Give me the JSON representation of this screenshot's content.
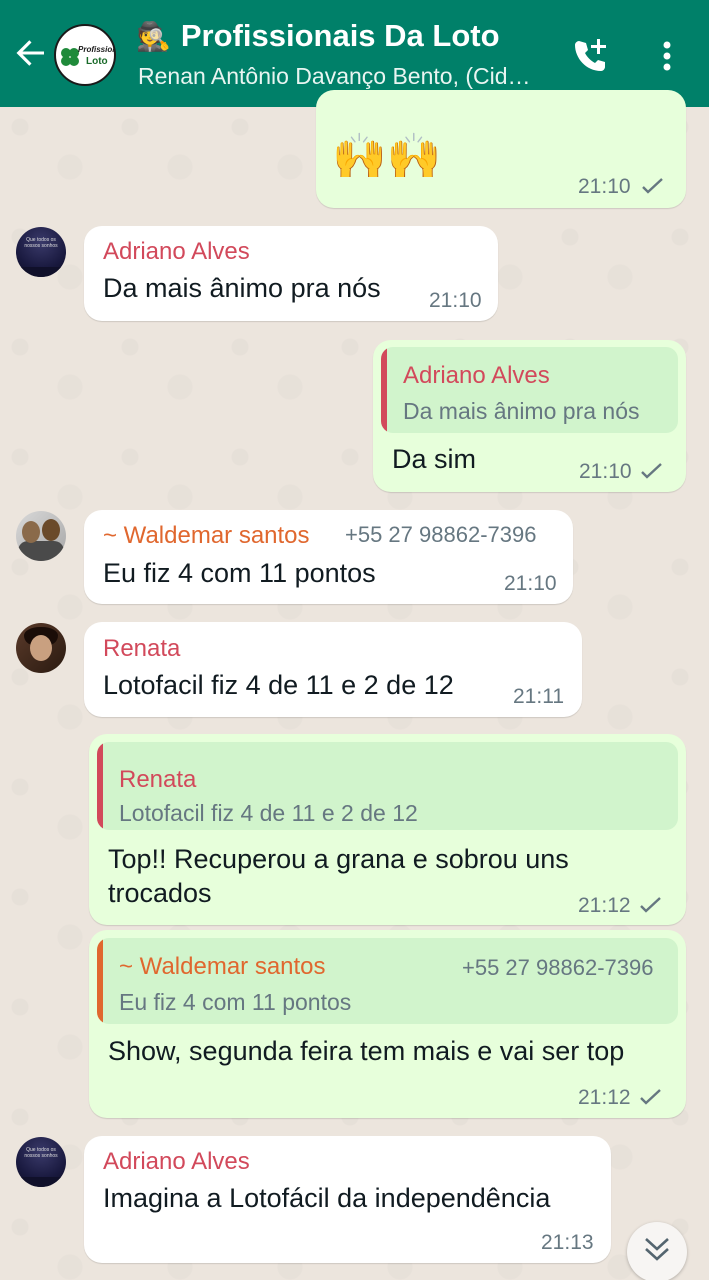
{
  "header": {
    "title": "Profissionais Da Loto",
    "title_emoji": "🕵",
    "subtitle": "Renan Antônio Davanço Bento, (Cid…",
    "avatar_line1": "Profissionais",
    "avatar_line2": "Loto"
  },
  "colors": {
    "header": "#008069",
    "incoming": "#ffffff",
    "outgoing": "#e7ffdb",
    "name_adriano": "#d2495b",
    "name_waldemar": "#e0672e",
    "name_renata": "#d2495b"
  },
  "messages": [
    {
      "direction": "out",
      "emoji": "🙌🙌",
      "time": "21:10"
    },
    {
      "direction": "in",
      "sender": "Adriano Alves",
      "text": "Da mais ânimo pra nós",
      "time": "21:10"
    },
    {
      "direction": "out",
      "quote_sender": "Adriano Alves",
      "quote_text": "Da mais ânimo pra nós",
      "text": "Da sim",
      "time": "21:10"
    },
    {
      "direction": "in",
      "sender": "~ Waldemar santos",
      "phone": "+55 27 98862-7396",
      "text": "Eu fiz 4 com 11 pontos",
      "time": "21:10"
    },
    {
      "direction": "in",
      "sender": "Renata",
      "text": "Lotofacil fiz 4 de 11 e 2 de 12",
      "time": "21:11"
    },
    {
      "direction": "out",
      "quote_sender": "Renata",
      "quote_text": "Lotofacil fiz 4 de 11 e 2 de 12",
      "text": "Top!! Recuperou a grana e sobrou uns trocados",
      "time": "21:12"
    },
    {
      "direction": "out",
      "quote_sender": "~ Waldemar santos",
      "quote_phone": "+55 27 98862-7396",
      "quote_text": "Eu fiz 4 com 11 pontos",
      "text": "Show, segunda feira tem mais e vai ser top",
      "time": "21:12"
    },
    {
      "direction": "in",
      "sender": "Adriano Alves",
      "text": "Imagina a Lotofácil da independência",
      "time": "21:13"
    }
  ]
}
